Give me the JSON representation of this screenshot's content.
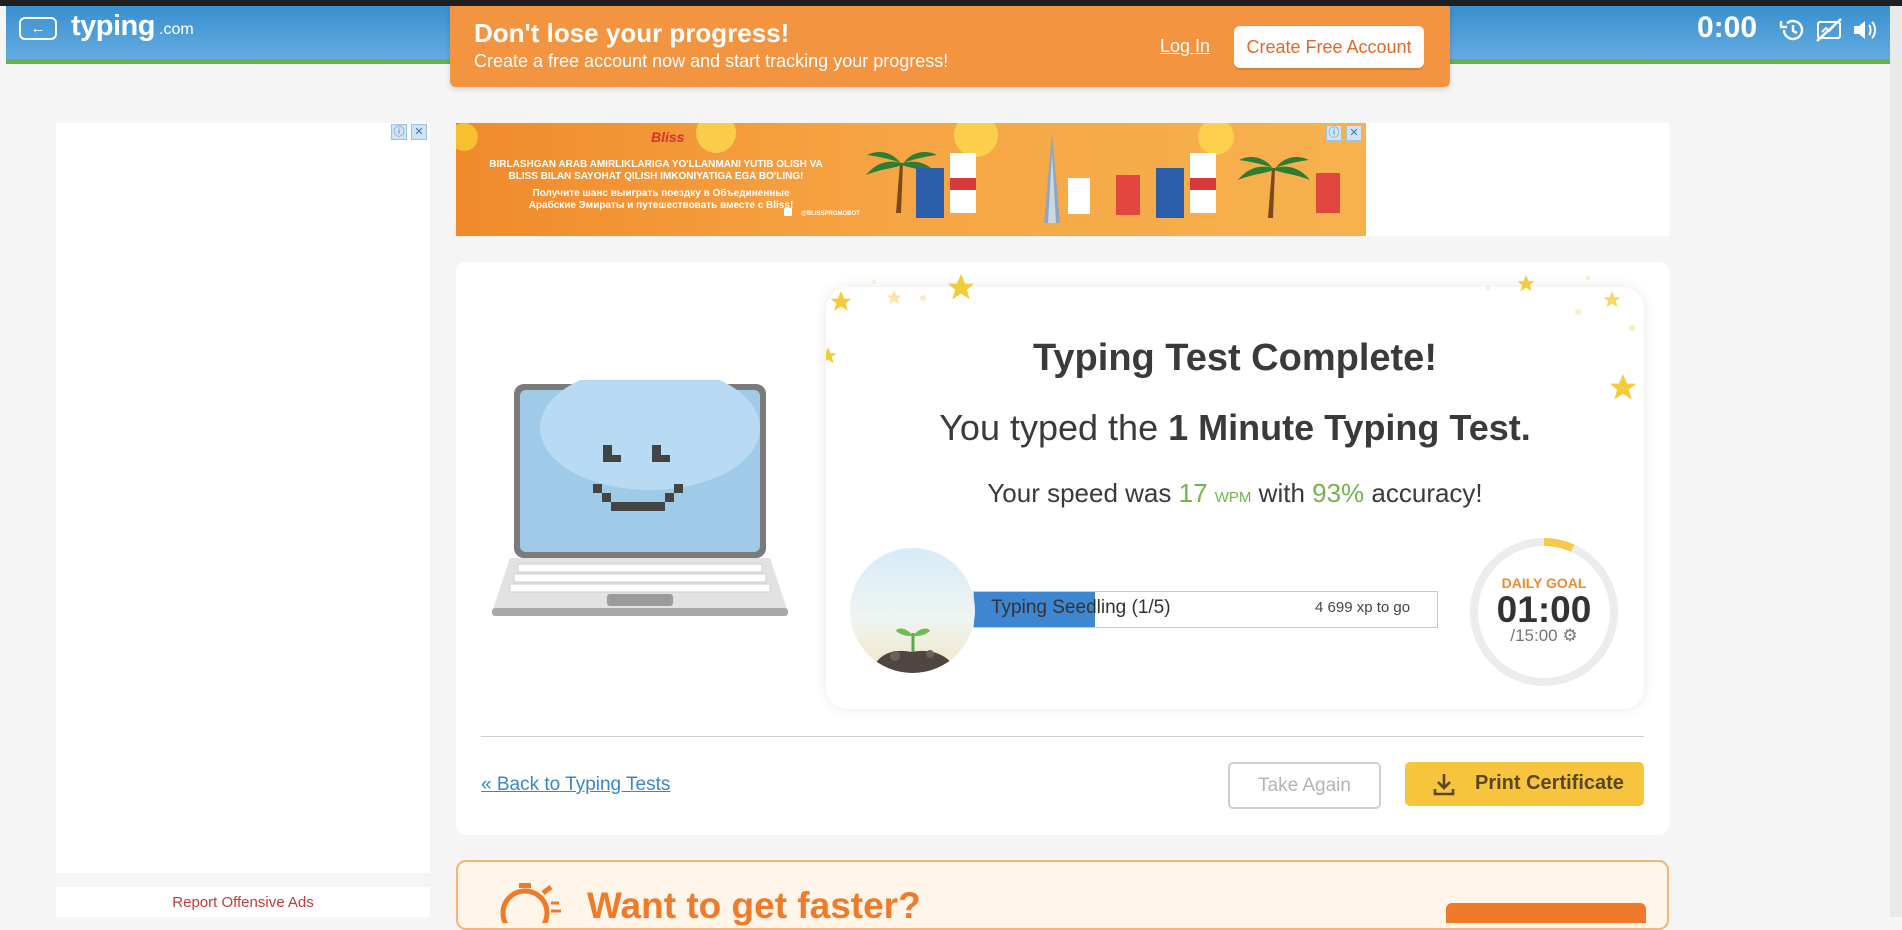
{
  "header": {
    "back_label": "←",
    "logo": "typing",
    "logo_suffix": ".com",
    "timer": "0:00",
    "icons": [
      "history-icon",
      "no-typing-icon",
      "volume-icon"
    ]
  },
  "signup_banner": {
    "title": "Don't lose your progress!",
    "subtitle": "Create a free account now and start tracking your progress!",
    "login_label": "Log In",
    "create_label": "Create Free Account"
  },
  "ads": {
    "report_label": "Report Offensive Ads",
    "adchoices_icon": "ⓘ",
    "close_icon": "✕",
    "top_ad": {
      "brand": "Bliss",
      "text_line1": "BIRLASHGAN ARAB AMIRLIKLARIGA YO'LLANMANI YUTIB OLISH VA BLISS BILAN SAYOHAT QILISH IMKONIYATIGA EGA BO'LING!",
      "text_line2": "Получите шанс выиграть поездку в Объединенные Арабские Эмираты и путешествовать вместе с Bliss!",
      "promo_handle": "@BLISSPROMOBOT"
    }
  },
  "results": {
    "title": "Typing Test Complete!",
    "line2_prefix": "You typed the ",
    "line2_test": "1 Minute Typing Test.",
    "line3_prefix": "Your speed was ",
    "wpm": "17",
    "wpm_unit": "WPM",
    "line3_mid": " with ",
    "accuracy": "93%",
    "line3_suffix": " accuracy!"
  },
  "level": {
    "label": "Typing Seedling (1/5)",
    "xp_to_go": "4 699 xp to go",
    "progress_fraction": 0.26
  },
  "daily_goal": {
    "title": "DAILY GOAL",
    "time": "01:00",
    "total": "/15:00 ⚙",
    "progress_fraction": 0.067
  },
  "actions": {
    "back_label": "« Back to Typing Tests",
    "take_again_label": "Take Again",
    "print_label": "Print Certificate"
  },
  "promo": {
    "title": "Want to get faster?"
  },
  "colors": {
    "header_blue": "#4c9cd6",
    "orange": "#f39441",
    "green": "#73b44d",
    "progress_blue": "#3f86d0",
    "print_yellow": "#f7c53d",
    "goal_orange": "#ef8a2d"
  }
}
